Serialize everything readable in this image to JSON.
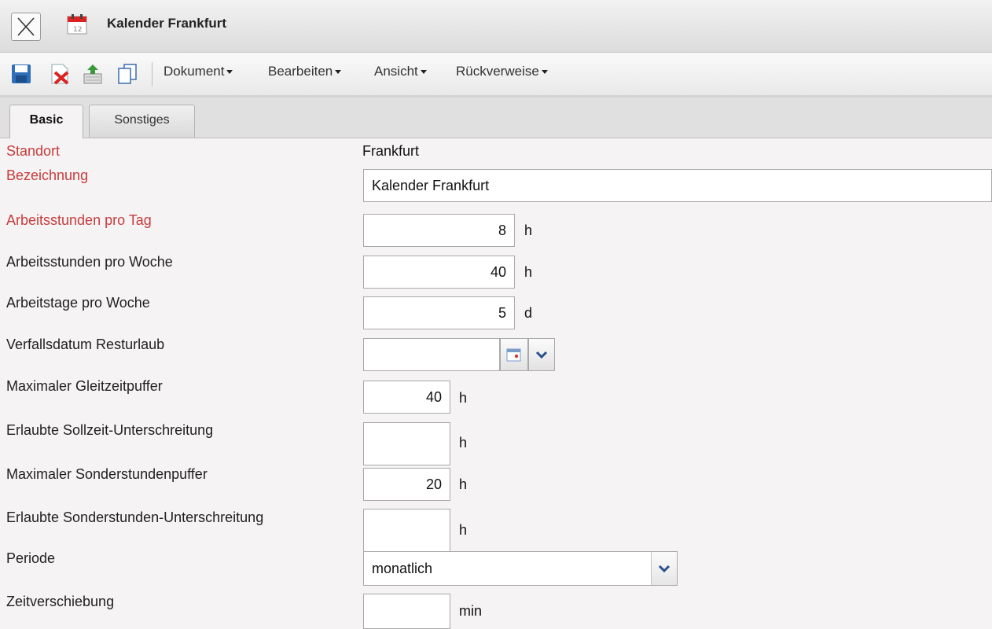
{
  "window": {
    "title": "Kalender Frankfurt"
  },
  "toolbar": {
    "icons": [
      "save-icon",
      "delete-icon",
      "export-icon",
      "copy-icon"
    ],
    "menus": [
      {
        "label": "Dokument"
      },
      {
        "label": "Bearbeiten"
      },
      {
        "label": "Ansicht"
      },
      {
        "label": "Rückverweise"
      }
    ]
  },
  "tabs": [
    {
      "label": "Basic",
      "active": true
    },
    {
      "label": "Sonstiges",
      "active": false
    }
  ],
  "form": {
    "standort": {
      "label": "Standort",
      "value": "Frankfurt",
      "required": true
    },
    "bezeichnung": {
      "label": "Bezeichnung",
      "value": "Kalender Frankfurt",
      "required": true
    },
    "arbeitsstunden_tag": {
      "label": "Arbeitsstunden pro Tag",
      "value": "8",
      "unit": "h",
      "required": true
    },
    "arbeitsstunden_woche": {
      "label": "Arbeitsstunden pro Woche",
      "value": "40",
      "unit": "h"
    },
    "arbeitstage_woche": {
      "label": "Arbeitstage pro Woche",
      "value": "5",
      "unit": "d"
    },
    "verfallsdatum": {
      "label": "Verfallsdatum Resturlaub",
      "value": ""
    },
    "gleitzeitpuffer": {
      "label": "Maximaler Gleitzeitpuffer",
      "value": "40",
      "unit": "h"
    },
    "sollzeit_unterschreitung": {
      "label": "Erlaubte Sollzeit-Unterschreitung",
      "value": "",
      "unit": "h"
    },
    "sonderstundenpuffer": {
      "label": "Maximaler Sonderstundenpuffer",
      "value": "20",
      "unit": "h"
    },
    "sonderstunden_unterschreitung": {
      "label": "Erlaubte Sonderstunden-Unterschreitung",
      "value": "",
      "unit": "h"
    },
    "periode": {
      "label": "Periode",
      "value": "monatlich"
    },
    "zeitverschiebung": {
      "label": "Zeitverschiebung",
      "value": "",
      "unit": "min"
    }
  },
  "colors": {
    "required_label": "#c83c3c",
    "background": "#f5f3f3"
  }
}
